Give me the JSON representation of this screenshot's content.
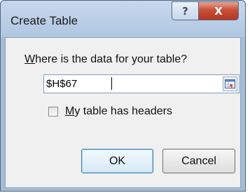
{
  "window": {
    "title": "Create Table",
    "help_glyph": "?",
    "close_glyph": "X"
  },
  "prompt": {
    "hotkey": "W",
    "rest": "here is the data for your table?"
  },
  "range": {
    "value": "$H$67"
  },
  "headers_checkbox": {
    "checked": false,
    "hotkey": "M",
    "rest": "y table has headers"
  },
  "buttons": {
    "ok_label": "OK",
    "cancel_label": "Cancel"
  },
  "icons": {
    "help": "question-mark-icon",
    "close": "close-x-icon",
    "collapse": "range-collapse-icon"
  },
  "colors": {
    "titlebar": "#b9cde5",
    "close_button": "#c8503a",
    "dialog_body": "#f0f0f0",
    "ok_focus_border": "#3c7fb1"
  }
}
